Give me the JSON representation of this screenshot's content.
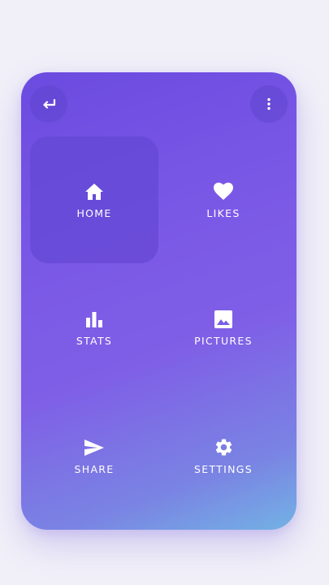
{
  "header": {
    "back_icon": "return-arrow-icon",
    "menu_icon": "more-vertical-icon"
  },
  "tiles": [
    {
      "label": "HOME",
      "icon": "home-icon",
      "active": true
    },
    {
      "label": "LIKES",
      "icon": "heart-icon",
      "active": false
    },
    {
      "label": "STATS",
      "icon": "bar-chart-icon",
      "active": false
    },
    {
      "label": "PICTURES",
      "icon": "image-icon",
      "active": false
    },
    {
      "label": "SHARE",
      "icon": "send-icon",
      "active": false
    },
    {
      "label": "SETTINGS",
      "icon": "gear-icon",
      "active": false
    }
  ],
  "colors": {
    "background": "#f1f0f8",
    "gradient_start": "#6b4ae0",
    "gradient_end": "#73b2e4",
    "active_tile": "#6448d4",
    "text": "#ffffff"
  }
}
